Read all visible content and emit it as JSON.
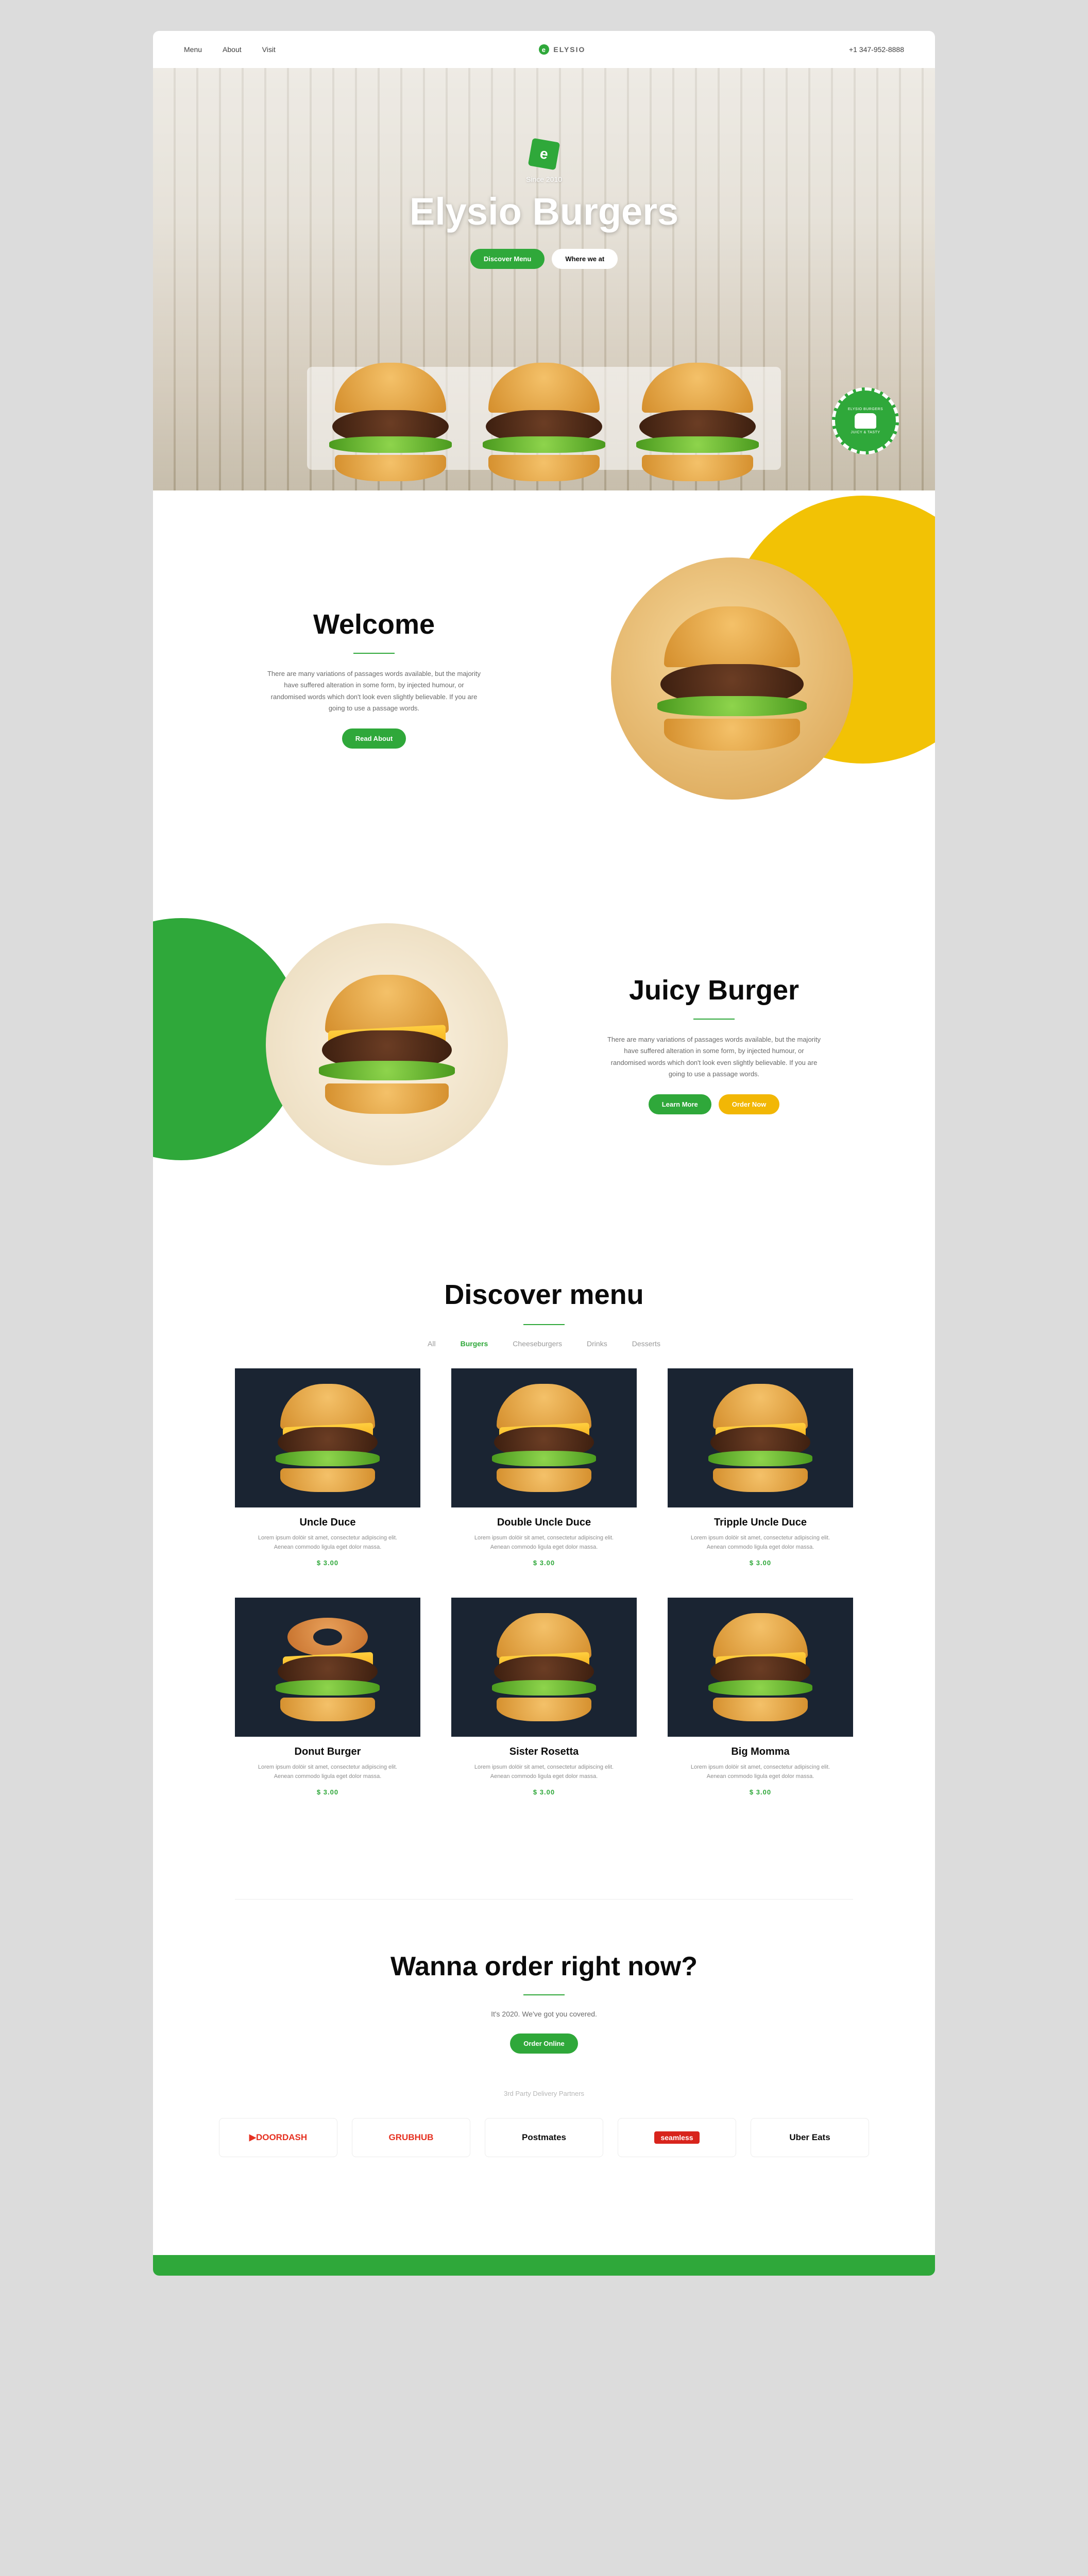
{
  "nav": {
    "items": [
      "Menu",
      "About",
      "Visit"
    ],
    "logo": "ELYSIO",
    "phone": "+1 347-952-8888"
  },
  "hero": {
    "since": "Since 2010",
    "title": "Elysio Burgers",
    "btn1": "Discover Menu",
    "btn2": "Where we at",
    "badge_top": "ELYSIO BURGERS",
    "badge_bot": "JUICY & TASTY"
  },
  "welcome": {
    "title": "Welcome",
    "body": "There are many variations of passages words available, but the majority have suffered alteration in some form, by injected humour, or randomised words which don't look even slightly believable. If you are going to use a passage words.",
    "btn": "Read About"
  },
  "juicy": {
    "title": "Juicy Burger",
    "body": "There are many variations of passages words available, but the majority have suffered alteration in some form, by injected humour, or randomised words which don't look even slightly believable. If you are going to use a passage words.",
    "btn1": "Learn More",
    "btn2": "Order Now"
  },
  "menu": {
    "title": "Discover menu",
    "tabs": [
      "All",
      "Burgers",
      "Cheeseburgers",
      "Drinks",
      "Desserts"
    ],
    "active": 1,
    "items": [
      {
        "name": "Uncle Duce",
        "desc": "Lorem ipsum dolöir sit amet, consectetur adipiscing elit. Aenean commodo ligula eget dolor massa.",
        "price": "$ 3.00"
      },
      {
        "name": "Double Uncle Duce",
        "desc": "Lorem ipsum dolöir sit amet, consectetur adipiscing elit. Aenean commodo ligula eget dolor massa.",
        "price": "$ 3.00"
      },
      {
        "name": "Tripple Uncle Duce",
        "desc": "Lorem ipsum dolöir sit amet, consectetur adipiscing elit. Aenean commodo ligula eget dolor massa.",
        "price": "$ 3.00"
      },
      {
        "name": "Donut Burger",
        "desc": "Lorem ipsum dolöir sit amet, consectetur adipiscing elit. Aenean commodo ligula eget dolor massa.",
        "price": "$ 3.00"
      },
      {
        "name": "Sister Rosetta",
        "desc": "Lorem ipsum dolöir sit amet, consectetur adipiscing elit. Aenean commodo ligula eget dolor massa.",
        "price": "$ 3.00"
      },
      {
        "name": "Big Momma",
        "desc": "Lorem ipsum dolöir sit amet, consectetur adipiscing elit. Aenean commodo ligula eget dolor massa.",
        "price": "$ 3.00"
      }
    ]
  },
  "cta": {
    "title": "Wanna order right now?",
    "sub": "It's 2020. We've got you covered.",
    "btn": "Order Online",
    "partners_label": "3rd Party Delivery Partners",
    "partners": [
      "DOORDASH",
      "GRUBHUB",
      "Postmates",
      "seamless",
      "Uber Eats"
    ]
  }
}
